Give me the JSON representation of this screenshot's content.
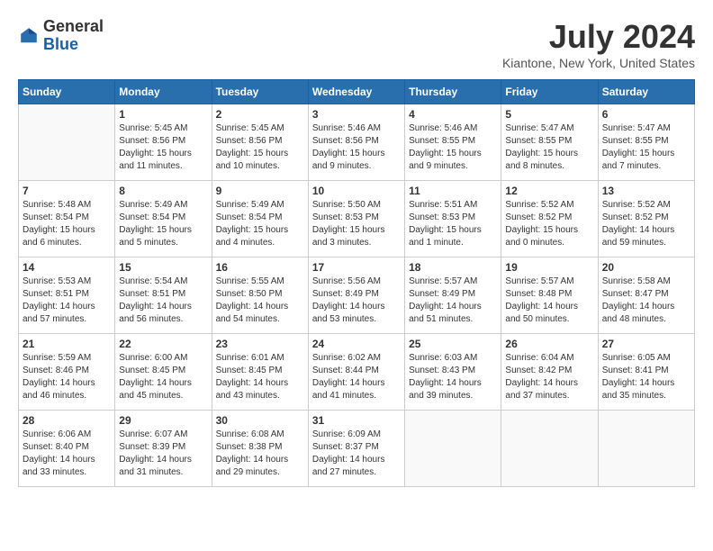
{
  "header": {
    "logo_line1": "General",
    "logo_line2": "Blue",
    "month_title": "July 2024",
    "location": "Kiantone, New York, United States"
  },
  "days_of_week": [
    "Sunday",
    "Monday",
    "Tuesday",
    "Wednesday",
    "Thursday",
    "Friday",
    "Saturday"
  ],
  "weeks": [
    [
      {
        "day": "",
        "sunrise": "",
        "sunset": "",
        "daylight": ""
      },
      {
        "day": "1",
        "sunrise": "Sunrise: 5:45 AM",
        "sunset": "Sunset: 8:56 PM",
        "daylight": "Daylight: 15 hours and 11 minutes."
      },
      {
        "day": "2",
        "sunrise": "Sunrise: 5:45 AM",
        "sunset": "Sunset: 8:56 PM",
        "daylight": "Daylight: 15 hours and 10 minutes."
      },
      {
        "day": "3",
        "sunrise": "Sunrise: 5:46 AM",
        "sunset": "Sunset: 8:56 PM",
        "daylight": "Daylight: 15 hours and 9 minutes."
      },
      {
        "day": "4",
        "sunrise": "Sunrise: 5:46 AM",
        "sunset": "Sunset: 8:55 PM",
        "daylight": "Daylight: 15 hours and 9 minutes."
      },
      {
        "day": "5",
        "sunrise": "Sunrise: 5:47 AM",
        "sunset": "Sunset: 8:55 PM",
        "daylight": "Daylight: 15 hours and 8 minutes."
      },
      {
        "day": "6",
        "sunrise": "Sunrise: 5:47 AM",
        "sunset": "Sunset: 8:55 PM",
        "daylight": "Daylight: 15 hours and 7 minutes."
      }
    ],
    [
      {
        "day": "7",
        "sunrise": "Sunrise: 5:48 AM",
        "sunset": "Sunset: 8:54 PM",
        "daylight": "Daylight: 15 hours and 6 minutes."
      },
      {
        "day": "8",
        "sunrise": "Sunrise: 5:49 AM",
        "sunset": "Sunset: 8:54 PM",
        "daylight": "Daylight: 15 hours and 5 minutes."
      },
      {
        "day": "9",
        "sunrise": "Sunrise: 5:49 AM",
        "sunset": "Sunset: 8:54 PM",
        "daylight": "Daylight: 15 hours and 4 minutes."
      },
      {
        "day": "10",
        "sunrise": "Sunrise: 5:50 AM",
        "sunset": "Sunset: 8:53 PM",
        "daylight": "Daylight: 15 hours and 3 minutes."
      },
      {
        "day": "11",
        "sunrise": "Sunrise: 5:51 AM",
        "sunset": "Sunset: 8:53 PM",
        "daylight": "Daylight: 15 hours and 1 minute."
      },
      {
        "day": "12",
        "sunrise": "Sunrise: 5:52 AM",
        "sunset": "Sunset: 8:52 PM",
        "daylight": "Daylight: 15 hours and 0 minutes."
      },
      {
        "day": "13",
        "sunrise": "Sunrise: 5:52 AM",
        "sunset": "Sunset: 8:52 PM",
        "daylight": "Daylight: 14 hours and 59 minutes."
      }
    ],
    [
      {
        "day": "14",
        "sunrise": "Sunrise: 5:53 AM",
        "sunset": "Sunset: 8:51 PM",
        "daylight": "Daylight: 14 hours and 57 minutes."
      },
      {
        "day": "15",
        "sunrise": "Sunrise: 5:54 AM",
        "sunset": "Sunset: 8:51 PM",
        "daylight": "Daylight: 14 hours and 56 minutes."
      },
      {
        "day": "16",
        "sunrise": "Sunrise: 5:55 AM",
        "sunset": "Sunset: 8:50 PM",
        "daylight": "Daylight: 14 hours and 54 minutes."
      },
      {
        "day": "17",
        "sunrise": "Sunrise: 5:56 AM",
        "sunset": "Sunset: 8:49 PM",
        "daylight": "Daylight: 14 hours and 53 minutes."
      },
      {
        "day": "18",
        "sunrise": "Sunrise: 5:57 AM",
        "sunset": "Sunset: 8:49 PM",
        "daylight": "Daylight: 14 hours and 51 minutes."
      },
      {
        "day": "19",
        "sunrise": "Sunrise: 5:57 AM",
        "sunset": "Sunset: 8:48 PM",
        "daylight": "Daylight: 14 hours and 50 minutes."
      },
      {
        "day": "20",
        "sunrise": "Sunrise: 5:58 AM",
        "sunset": "Sunset: 8:47 PM",
        "daylight": "Daylight: 14 hours and 48 minutes."
      }
    ],
    [
      {
        "day": "21",
        "sunrise": "Sunrise: 5:59 AM",
        "sunset": "Sunset: 8:46 PM",
        "daylight": "Daylight: 14 hours and 46 minutes."
      },
      {
        "day": "22",
        "sunrise": "Sunrise: 6:00 AM",
        "sunset": "Sunset: 8:45 PM",
        "daylight": "Daylight: 14 hours and 45 minutes."
      },
      {
        "day": "23",
        "sunrise": "Sunrise: 6:01 AM",
        "sunset": "Sunset: 8:45 PM",
        "daylight": "Daylight: 14 hours and 43 minutes."
      },
      {
        "day": "24",
        "sunrise": "Sunrise: 6:02 AM",
        "sunset": "Sunset: 8:44 PM",
        "daylight": "Daylight: 14 hours and 41 minutes."
      },
      {
        "day": "25",
        "sunrise": "Sunrise: 6:03 AM",
        "sunset": "Sunset: 8:43 PM",
        "daylight": "Daylight: 14 hours and 39 minutes."
      },
      {
        "day": "26",
        "sunrise": "Sunrise: 6:04 AM",
        "sunset": "Sunset: 8:42 PM",
        "daylight": "Daylight: 14 hours and 37 minutes."
      },
      {
        "day": "27",
        "sunrise": "Sunrise: 6:05 AM",
        "sunset": "Sunset: 8:41 PM",
        "daylight": "Daylight: 14 hours and 35 minutes."
      }
    ],
    [
      {
        "day": "28",
        "sunrise": "Sunrise: 6:06 AM",
        "sunset": "Sunset: 8:40 PM",
        "daylight": "Daylight: 14 hours and 33 minutes."
      },
      {
        "day": "29",
        "sunrise": "Sunrise: 6:07 AM",
        "sunset": "Sunset: 8:39 PM",
        "daylight": "Daylight: 14 hours and 31 minutes."
      },
      {
        "day": "30",
        "sunrise": "Sunrise: 6:08 AM",
        "sunset": "Sunset: 8:38 PM",
        "daylight": "Daylight: 14 hours and 29 minutes."
      },
      {
        "day": "31",
        "sunrise": "Sunrise: 6:09 AM",
        "sunset": "Sunset: 8:37 PM",
        "daylight": "Daylight: 14 hours and 27 minutes."
      },
      {
        "day": "",
        "sunrise": "",
        "sunset": "",
        "daylight": ""
      },
      {
        "day": "",
        "sunrise": "",
        "sunset": "",
        "daylight": ""
      },
      {
        "day": "",
        "sunrise": "",
        "sunset": "",
        "daylight": ""
      }
    ]
  ]
}
